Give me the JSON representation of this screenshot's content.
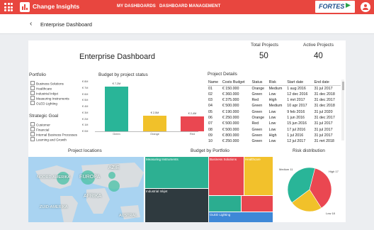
{
  "app": {
    "title": "Change Insights",
    "nav": [
      "MY DASHBOARDS",
      "DASHBOARD MANAGEMENT"
    ],
    "brand": "FORTES"
  },
  "colors": {
    "topbar": "#e8463f",
    "green": "#29b598",
    "yellow": "#f1c12a",
    "red": "#ea4751",
    "blue": "#3e88d7",
    "dark": "#2f3a3f",
    "map_bubble": "#4fc3a9"
  },
  "breadcrumb": {
    "title": "Enterprise Dashboard"
  },
  "dashboard": {
    "title": "Enterprise Dashboard",
    "kpis": [
      {
        "label": "Total Projects",
        "value": "50"
      },
      {
        "label": "Active Projects",
        "value": "40"
      }
    ]
  },
  "filters": {
    "portfolio_title": "Portfolio",
    "portfolio": [
      "Business Solutions",
      "Healthcare",
      "Industrial Inkjet",
      "Measuring Instruments",
      "OLED Lighting"
    ],
    "goal_title": "Strategic Goal",
    "goal": [
      "Customer",
      "Financial",
      "Internal Business Processes",
      "Learning and Growth"
    ]
  },
  "status_chart": {
    "title": "Budget by project status"
  },
  "project_details": {
    "title": "Project Details",
    "columns": [
      "Name",
      "Costs Budget",
      "Status",
      "Risk",
      "Start date",
      "End date"
    ],
    "rows": [
      [
        "01",
        "€ 150.000",
        "Orange",
        "Medium",
        "1 aug 2016",
        "31 jul 2017"
      ],
      [
        "02",
        "€ 360.000",
        "Green",
        "Low",
        "12 dec 2016",
        "31 dec 2018"
      ],
      [
        "03",
        "€ 375.000",
        "Red",
        "High",
        "1 mrt 2017",
        "31 dec 2017"
      ],
      [
        "04",
        "€ 500.000",
        "Green",
        "Medium",
        "10 apr 2017",
        "31 dec 2018"
      ],
      [
        "05",
        "€ 190.000",
        "Green",
        "Low",
        "9 feb 2016",
        "31 jul 2020"
      ],
      [
        "06",
        "€ 250.000",
        "Orange",
        "Low",
        "1 jun 2016",
        "31 dec 2017"
      ],
      [
        "07",
        "€ 500.000",
        "Red",
        "Low",
        "15 jun 2016",
        "31 jul 2017"
      ],
      [
        "08",
        "€ 500.000",
        "Green",
        "Low",
        "17 jul 2016",
        "31 jul 2017"
      ],
      [
        "09",
        "€ 800.000",
        "Green",
        "High",
        "1 jul 2016",
        "31 jul 2017"
      ],
      [
        "10",
        "€ 250.000",
        "Green",
        "Low",
        "12 jul 2017",
        "31 mrt 2018"
      ]
    ]
  },
  "sections": {
    "locations": "Project locations",
    "portfolio_budget": "Budget by Portfolio",
    "risk": "Risk distribution"
  },
  "map_labels": [
    "NOORD-AMERIKA",
    "EUROPA",
    "AZIE",
    "AFRIKA",
    "ZUID-AMERIKA",
    "AUSTRAL"
  ],
  "treemap": [
    "Measuring Instruments",
    "Business Solutions",
    "Healthcare",
    "Industrial Inkjet",
    "OLED Lighting"
  ],
  "chart_data": [
    {
      "type": "bar",
      "title": "Budget by project status",
      "categories": [
        "Green",
        "Orange",
        "Red"
      ],
      "values": [
        7.2,
        2.5,
        2.4
      ],
      "data_labels": [
        "€ 7,2M",
        "€ 2,5M",
        "€ 2,4M"
      ],
      "yticks": [
        "€ 8M",
        "€ 7M",
        "€ 6M",
        "€ 5M",
        "€ 4M",
        "€ 3M",
        "€ 2M",
        "€ 1M",
        "€ 0M"
      ],
      "ylim": [
        0,
        8
      ],
      "ylabel": "",
      "xlabel": ""
    },
    {
      "type": "pie",
      "title": "Risk distribution",
      "categories": [
        "High",
        "Medium",
        "Low"
      ],
      "labels": [
        "High 17",
        "Medium 11",
        "Low 18"
      ],
      "values": [
        17,
        11,
        18
      ]
    }
  ]
}
